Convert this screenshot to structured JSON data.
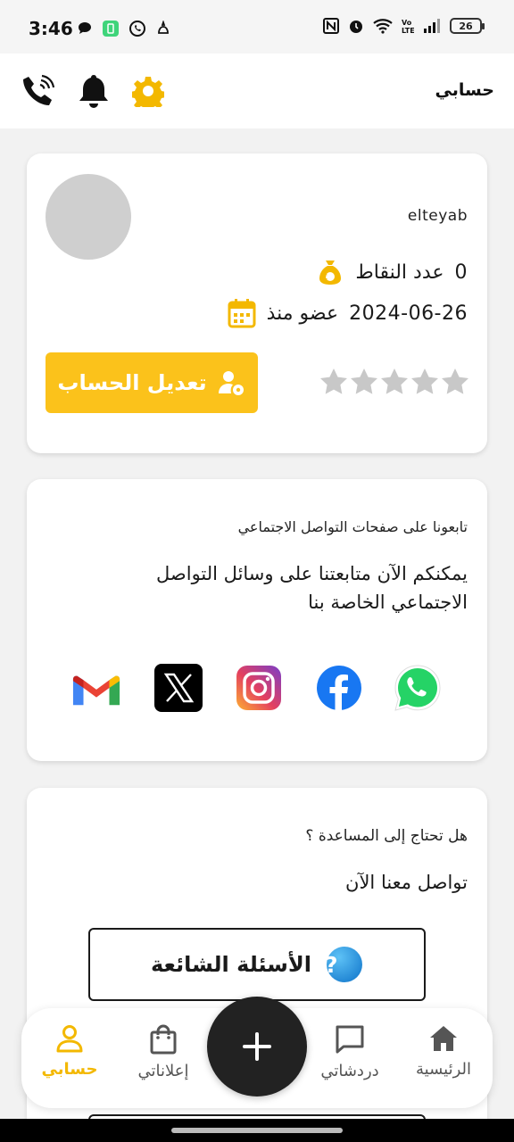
{
  "status_bar": {
    "time": "3:46",
    "battery": "26",
    "left_icons": [
      "chat-bubble-icon",
      "sim-card-icon",
      "whatsapp-icon",
      "notification-icon"
    ],
    "right_icons": [
      "nfc-icon",
      "alarm-icon",
      "wifi-icon",
      "volte-icon",
      "signal-icon"
    ]
  },
  "header": {
    "title": "حسابي",
    "icons": [
      "phone-icon",
      "bell-icon",
      "gear-icon"
    ]
  },
  "profile": {
    "username": "elteyab",
    "points_label": "عدد النقاط",
    "points_value": "0",
    "member_since_label": "عضو منذ",
    "member_since_value": "2024-06-26",
    "edit_button": "تعديل الحساب",
    "rating_stars": 5,
    "rating_value": 0
  },
  "social": {
    "subtitle": "تابعونا على صفحات التواصل الاجتماعي",
    "text": "يمكنكم الآن متابعتنا على وسائل التواصل الاجتماعي الخاصة بنا",
    "links": [
      "gmail-icon",
      "x-icon",
      "instagram-icon",
      "facebook-icon",
      "whatsapp-icon"
    ]
  },
  "help": {
    "subtitle": "هل تحتاج إلى المساعدة ؟",
    "title": "تواصل معنا الآن",
    "faq_button": "الأسئلة الشائعة"
  },
  "bottom_nav": {
    "items": [
      {
        "label": "الرئيسية",
        "icon": "home-icon"
      },
      {
        "label": "دردشاتي",
        "icon": "chat-icon"
      },
      {
        "label": "إعلاناتي",
        "icon": "shopping-bag-icon"
      },
      {
        "label": "حسابي",
        "icon": "person-icon",
        "active": true
      }
    ],
    "fab_icon": "plus-icon"
  },
  "colors": {
    "accent": "#FBC21B",
    "dark": "#222222",
    "star": "#C8C8C8"
  }
}
